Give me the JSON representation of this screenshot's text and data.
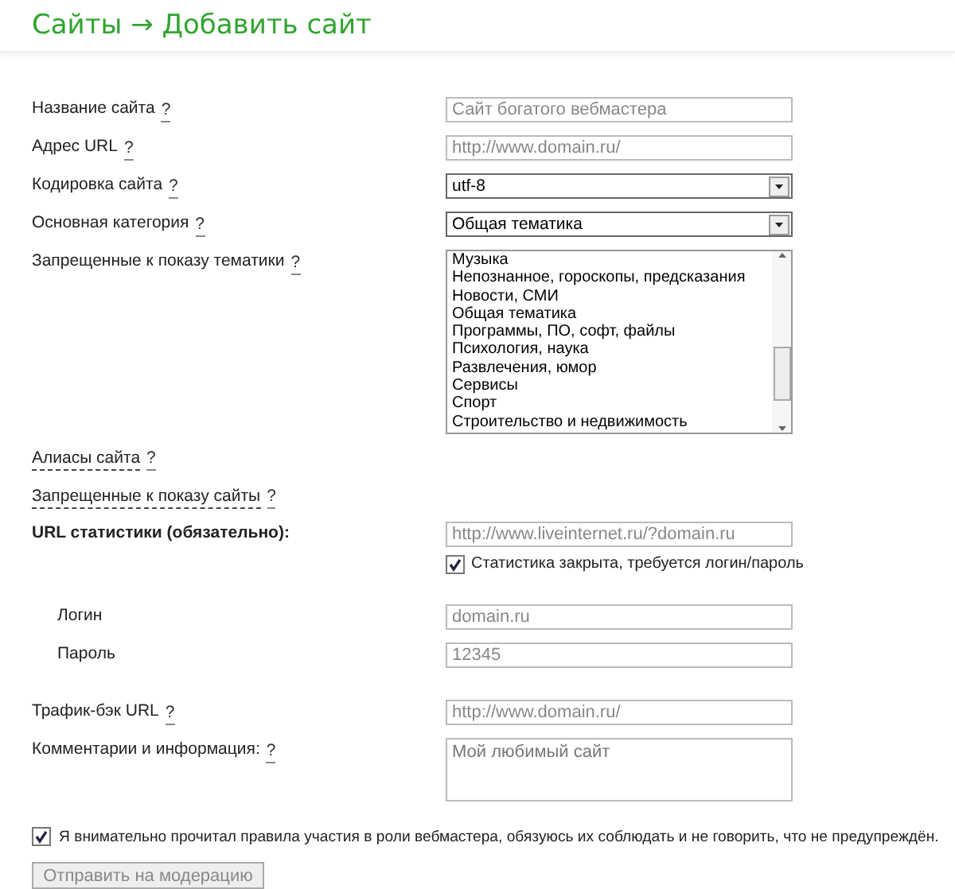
{
  "header": {
    "title": "Сайты → Добавить сайт"
  },
  "rows": [
    {
      "kind": "text",
      "label": "Название сайта",
      "help": "?",
      "placeholder": "Сайт богатого вебмастера"
    },
    {
      "kind": "text",
      "label": "Адрес URL",
      "help": "?",
      "placeholder": "http://www.domain.ru/"
    },
    {
      "kind": "select",
      "label": "Кодировка сайта",
      "help": "?",
      "value": "utf-8"
    },
    {
      "kind": "select",
      "label": "Основная категория",
      "help": "?",
      "value": "Общая тематика"
    },
    {
      "kind": "listbox",
      "label": "Запрещенные к показу тематики",
      "help": "?",
      "options": [
        {
          "label": "Музыка",
          "selected": false
        },
        {
          "label": "Непознанное, гороскопы, предсказания",
          "selected": false
        },
        {
          "label": "Новости, СМИ",
          "selected": false
        },
        {
          "label": "Общая тематика",
          "selected": false
        },
        {
          "label": "Программы, ПО, софт, файлы",
          "selected": false
        },
        {
          "label": "Психология, наука",
          "selected": false
        },
        {
          "label": "Развлечения, юмор",
          "selected": false
        },
        {
          "label": "Сервисы",
          "selected": false
        },
        {
          "label": "Спорт",
          "selected": false
        },
        {
          "label": "Строительство и недвижимость",
          "selected": false
        }
      ]
    },
    {
      "kind": "toggle",
      "label": "Алиасы сайта",
      "help": "?"
    },
    {
      "kind": "toggle",
      "label": "Запрещенные к показу сайты",
      "help": "?"
    },
    {
      "kind": "stat",
      "label": "URL статистики (обязательно):",
      "placeholder": "http://www.liveinternet.ru/?domain.ru",
      "checkbox": {
        "label": "Статистика закрыта, требуется логин/пароль",
        "checked": true
      }
    },
    {
      "kind": "text",
      "label": "Логин",
      "indented": true,
      "placeholder": "domain.ru"
    },
    {
      "kind": "text",
      "label": "Пароль",
      "indented": true,
      "placeholder": "12345"
    },
    {
      "kind": "text",
      "label": "Трафик-бэк URL",
      "help": "?",
      "placeholder": "http://www.domain.ru/"
    },
    {
      "kind": "textarea",
      "label": "Комментарии и информация:",
      "help": "?",
      "placeholder": "Мой любимый сайт"
    }
  ],
  "agreement": {
    "checked": true,
    "before": "Я внимательно прочитал",
    "link": "правила участия в роли вебмастера",
    "after": ", обязуюсь их соблюдать и не говорить, что не предупреждён."
  },
  "submit": {
    "label": "Отправить на модерацию",
    "disabled": true
  }
}
